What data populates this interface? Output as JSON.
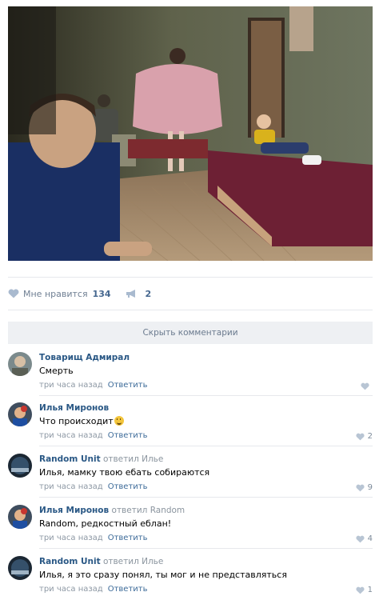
{
  "post": {
    "likes_label": "Мне нравится",
    "likes_count": "134",
    "shares_count": "2",
    "hide_comments_label": "Скрыть комментарии"
  },
  "comments": [
    {
      "author": "Товарищ Адмирал",
      "reply_to": "",
      "text": "Смерть",
      "time": "три часа назад",
      "reply_label": "Ответить",
      "likes": ""
    },
    {
      "author": "Илья Миронов",
      "reply_to": "",
      "text": "Что происходит",
      "emoji": "grinning-sweat-emoji",
      "time": "три часа назад",
      "reply_label": "Ответить",
      "likes": "2"
    },
    {
      "author": "Random Unit",
      "reply_to": "ответил Илье",
      "text": "Илья, мамку твою ебать собираются",
      "time": "три часа назад",
      "reply_label": "Ответить",
      "likes": "9"
    },
    {
      "author": "Илья Миронов",
      "reply_to": "ответил Random",
      "text": "Random, редкостный еблан!",
      "time": "три часа назад",
      "reply_label": "Ответить",
      "likes": "4"
    },
    {
      "author": "Random Unit",
      "reply_to": "ответил Илье",
      "text": "Илья, я это сразу понял, ты мог и не представляться",
      "time": "три часа назад",
      "reply_label": "Ответить",
      "likes": "1"
    }
  ],
  "colors": {
    "link": "#2a5885",
    "meta": "#8d98a4",
    "like_icon": "#b8c5d4"
  }
}
